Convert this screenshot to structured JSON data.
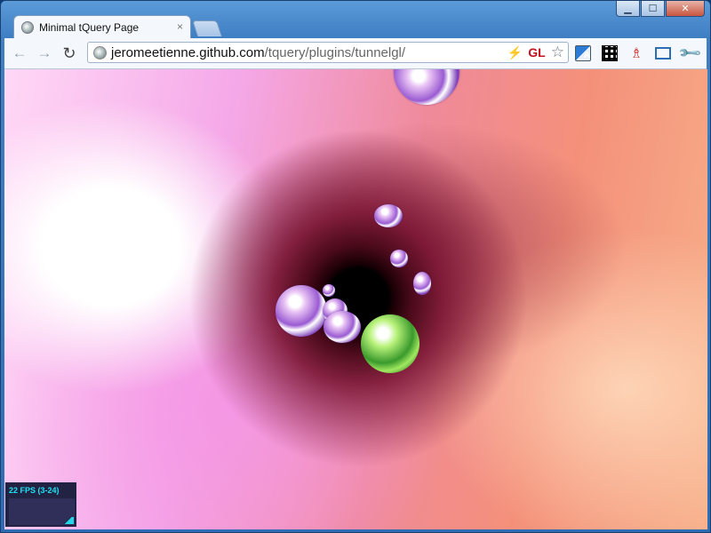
{
  "window": {
    "controls": {
      "minimize": "▁",
      "maximize": "☐",
      "close": "✕"
    }
  },
  "tabs": [
    {
      "title": "Minimal tQuery Page",
      "close": "×"
    }
  ],
  "toolbar": {
    "back": "←",
    "forward": "→",
    "reload": "↻",
    "url_host": "jeromeetienne.github.com",
    "url_path": "/tquery/plugins/tunnelgl/",
    "bolt": "⚡",
    "gl_badge": "GL",
    "star": "☆",
    "translate_glyph": "A",
    "person_glyph": "♗",
    "wrench_glyph": "🔧"
  },
  "viewport": {
    "fps_label": "22 FPS (3-24)"
  },
  "icons": [
    "globe-icon",
    "back-arrow-icon",
    "forward-arrow-icon",
    "reload-icon",
    "bolt-icon",
    "star-icon",
    "translate-icon",
    "qr-code-icon",
    "person-icon",
    "fullscreen-icon",
    "wrench-icon"
  ]
}
